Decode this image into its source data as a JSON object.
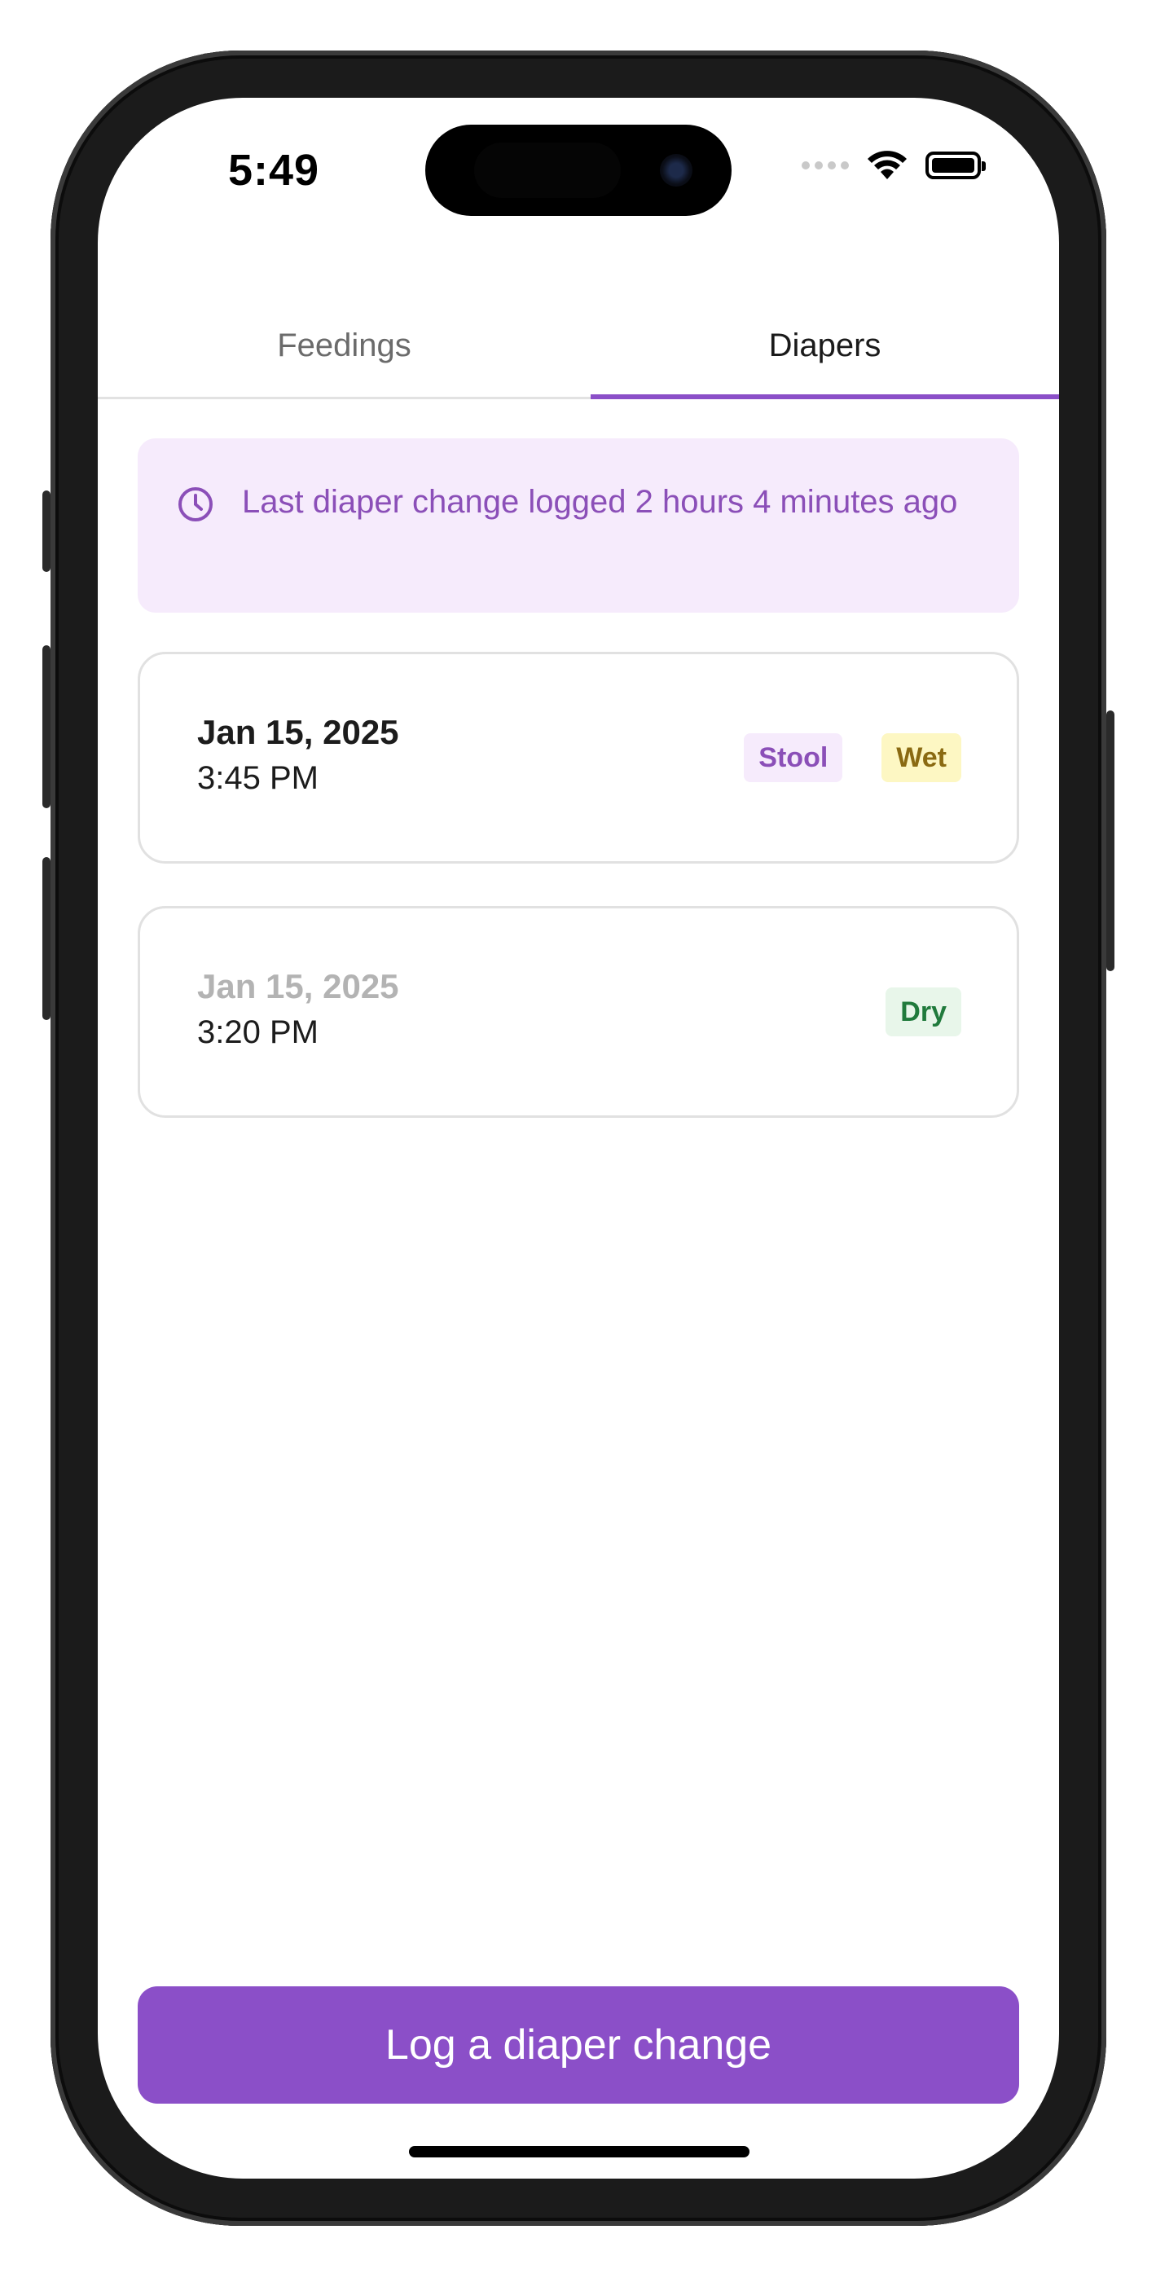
{
  "status_bar": {
    "time": "5:49"
  },
  "tabs": [
    {
      "label": "Feedings",
      "active": false
    },
    {
      "label": "Diapers",
      "active": true
    }
  ],
  "banner": {
    "icon": "clock-icon",
    "text": "Last diaper change logged 2 hours 4 minutes ago"
  },
  "entries": [
    {
      "date": "Jan 15, 2025",
      "time": "3:45 PM",
      "badges": [
        "Stool",
        "Wet"
      ]
    },
    {
      "date": "Jan 15, 2025",
      "time": "3:20 PM",
      "badges": [
        "Dry"
      ]
    }
  ],
  "primary_action": {
    "label": "Log a diaper change"
  },
  "colors": {
    "accent": "#8b4fc8",
    "banner_bg": "#f6ebfc",
    "stool_badge_bg": "#f6ebfc",
    "wet_badge_bg": "#fdf7c3",
    "dry_badge_bg": "#e8f6ea"
  }
}
